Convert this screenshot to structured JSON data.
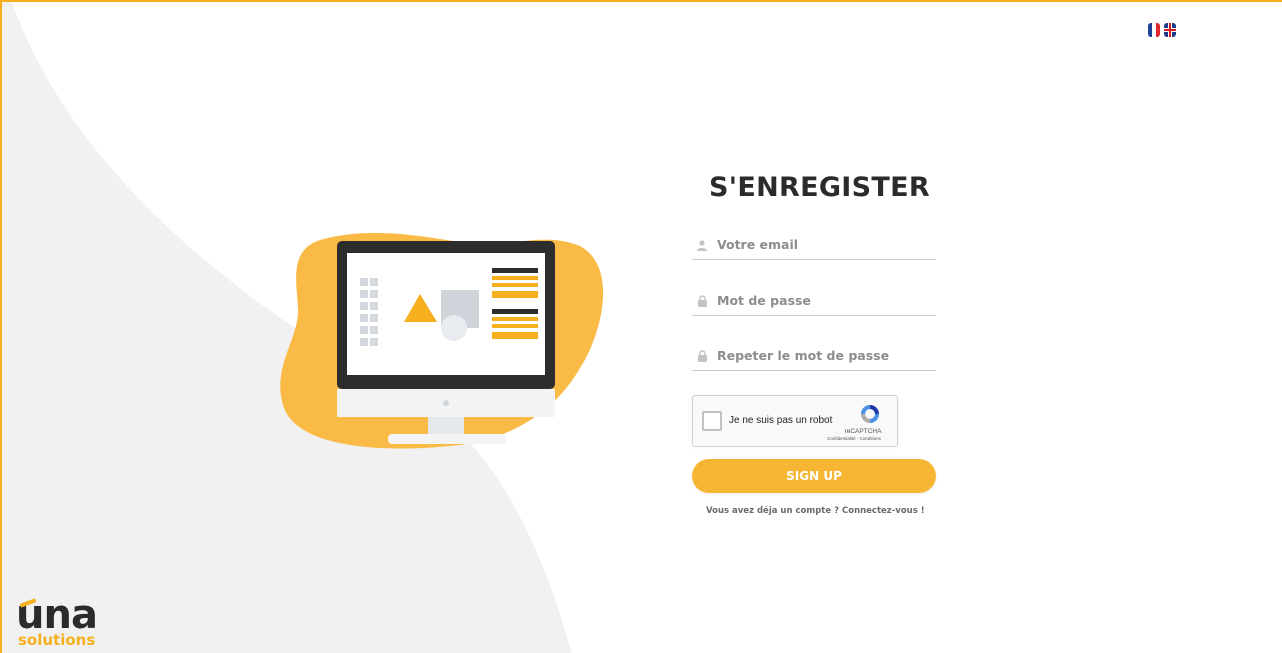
{
  "languages": [
    {
      "code": "fr",
      "name": "Français"
    },
    {
      "code": "en",
      "name": "English"
    }
  ],
  "form": {
    "title": "S'ENREGISTER",
    "email_placeholder": "Votre email",
    "password_placeholder": "Mot de passe",
    "repeat_password_placeholder": "Repeter le mot de passe",
    "captcha": {
      "label": "Je ne suis pas un robot",
      "brand": "reCAPTCHA",
      "terms": "Confidentialité - Conditions"
    },
    "submit_label": "SIGN UP",
    "signin_link": "Vous avez déja un compte ? Connectez-vous !"
  },
  "logo": {
    "mark": "una",
    "sub": "solutions"
  },
  "colors": {
    "accent": "#f6b01e",
    "button": "#f6b633",
    "background_shape": "#f1f1f1",
    "text_dark": "#2b2b2b"
  }
}
